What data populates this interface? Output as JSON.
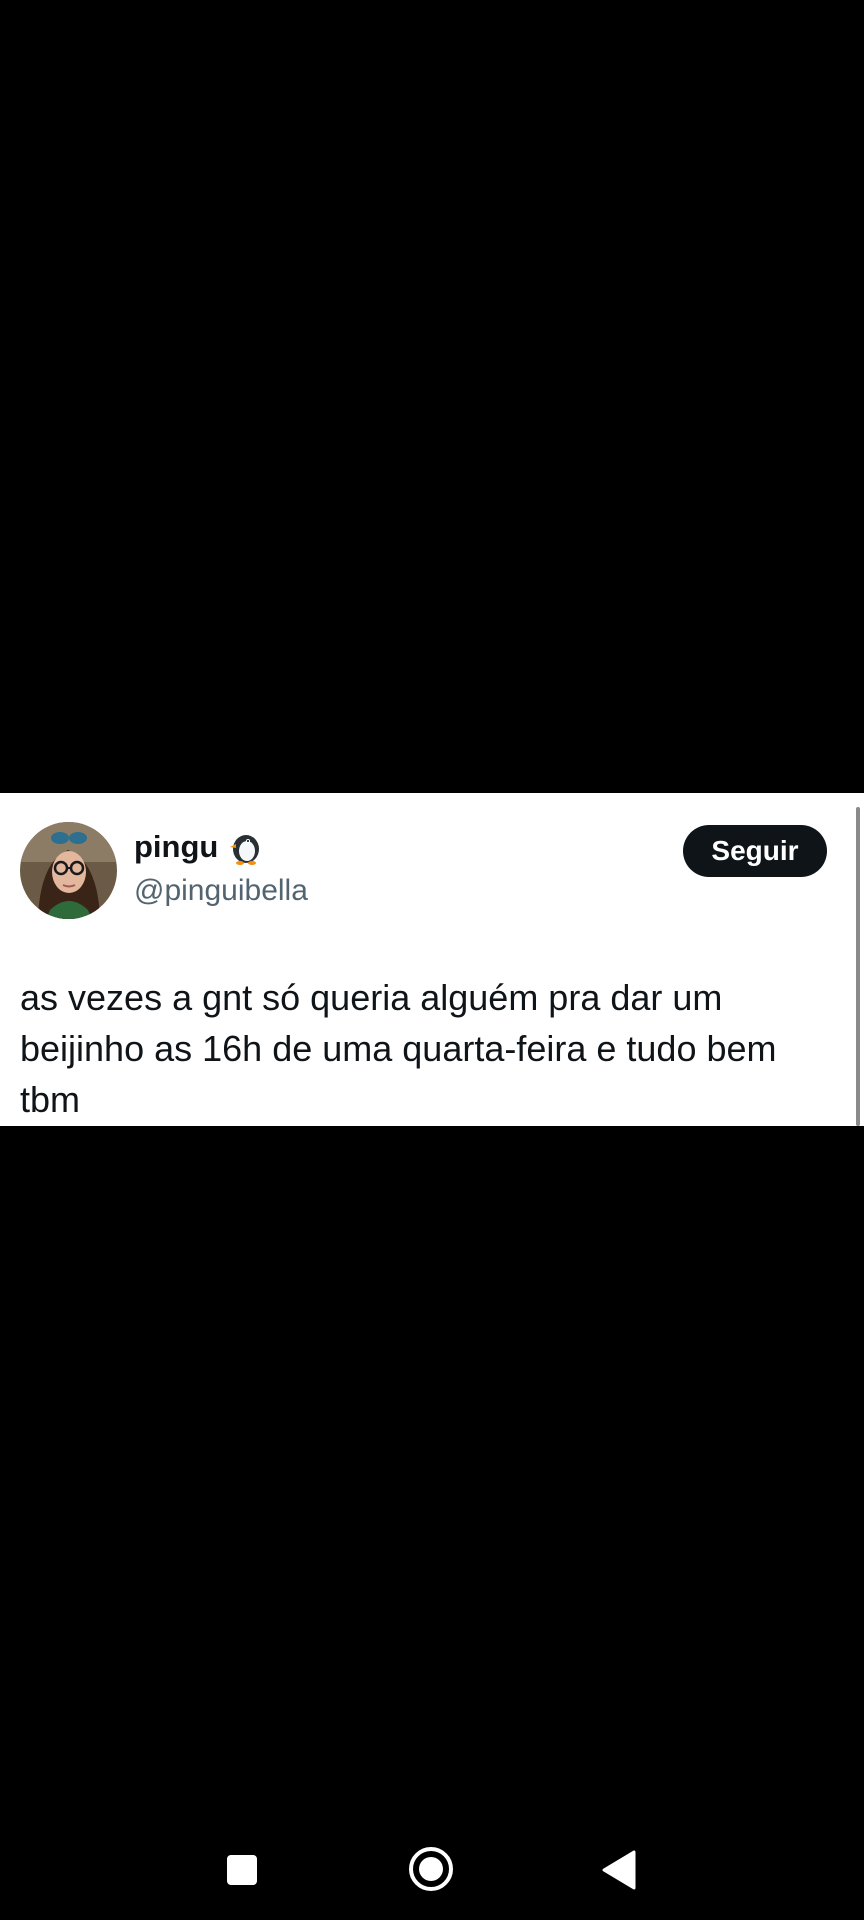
{
  "tweet": {
    "display_name": "pingu",
    "name_emoji_icon": "penguin-icon",
    "handle": "@pinguibella",
    "follow_label": "Seguir",
    "text": "as vezes a gnt só queria alguém pra dar um beijinho as 16h de uma quarta-feira e tudo bem tbm"
  },
  "nav_bar": {
    "buttons": [
      "recents-icon",
      "home-icon",
      "back-icon"
    ]
  },
  "colors": {
    "background": "#000000",
    "card": "#ffffff",
    "text_primary": "#0f1419",
    "text_secondary": "#536471",
    "button_bg": "#0f1419"
  }
}
